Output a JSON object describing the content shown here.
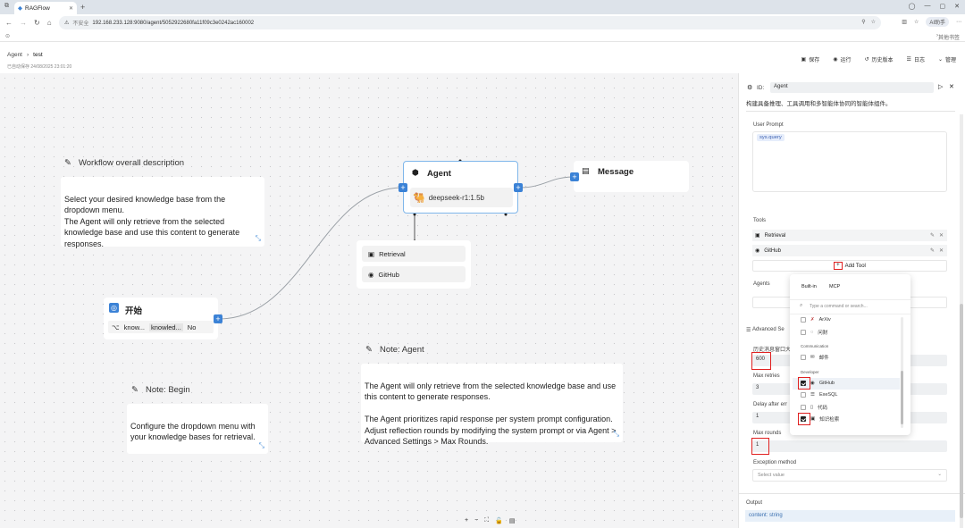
{
  "browser": {
    "tab_title": "RAGFlow",
    "insecure_label": "不安全",
    "url": "192.168.233.128:9080/agent/5052922680fa11f09c3e0242ac160002",
    "ai_label": "AI助手",
    "bookmarks_label": "其他书签"
  },
  "header": {
    "breadcrumb_root": "Agent",
    "breadcrumb_current": "test",
    "saved_text": "已自动保存 24/08/2025 23:01:20",
    "actions": [
      "保存",
      "运行",
      "历史版本",
      "日志",
      "管理"
    ]
  },
  "canvas": {
    "workflow_note": {
      "title": "Workflow overall description",
      "body": "Select your desired knowledge base from the dropdown menu.\nThe Agent will only retrieve from the selected knowledge base and use this content  to generate responses."
    },
    "agent_node": {
      "title": "Agent",
      "model": "deepseek-r1:1.5b"
    },
    "message_node": {
      "title": "Message"
    },
    "tools": [
      "Retrieval",
      "GitHub"
    ],
    "begin_node": {
      "title": "开始",
      "param_name": "know...",
      "param_value": "knowled...",
      "param_flag": "No"
    },
    "note_agent": {
      "title": "Note: Agent",
      "body": "The Agent will only retrieve from the selected knowledge base and use this content  to generate responses.\n\nThe Agent prioritizes rapid response per system prompt configuration. Adjust reflection rounds by modifying the system prompt or via Agent > Advanced Settings > Max Rounds."
    },
    "note_begin": {
      "title": "Note: Begin",
      "body": "Configure the dropdown menu with your knowledge bases for retrieval."
    }
  },
  "panel": {
    "id_label": "ID:",
    "id_value": "Agent",
    "description": "构建具备推理、工具调用和多智能体协同的智能体组件。",
    "user_prompt_label": "User Prompt",
    "user_prompt_value": "sys.query",
    "tools_label": "Tools",
    "tools": [
      "Retrieval",
      "GitHub"
    ],
    "add_tool": "Add Tool",
    "agents_label": "Agents",
    "advanced_label": "Advanced Se",
    "history_label": "历史消息窗口大",
    "history_value": "600",
    "max_retries_label": "Max retries",
    "max_retries_value": "3",
    "delay_label": "Delay after err",
    "delay_value": "1",
    "max_rounds_label": "Max rounds",
    "max_rounds_value": "1",
    "exception_label": "Exception method",
    "exception_placeholder": "Select value",
    "output_label": "Output",
    "output_value": "content: string"
  },
  "dropdown": {
    "tabs": [
      "Built-in",
      "MCP"
    ],
    "search_placeholder": "Type a command or search...",
    "items_top": [
      "ArXiv",
      "问财"
    ],
    "group_communication": "Communication",
    "items_comm": [
      "邮件"
    ],
    "group_developer": "Developer",
    "items_dev": [
      {
        "label": "GitHub",
        "checked": true
      },
      {
        "label": "ExeSQL",
        "checked": false
      },
      {
        "label": "代码",
        "checked": false
      },
      {
        "label": "知识检索",
        "checked": true
      }
    ]
  }
}
